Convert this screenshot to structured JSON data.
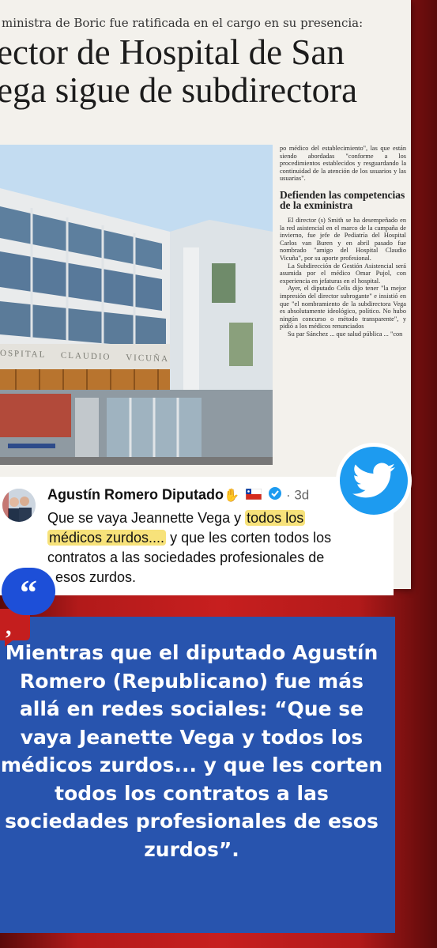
{
  "article": {
    "kicker": "ministra de Boric fue ratificada en el cargo en su presencia:",
    "headline_line1": "ector de Hospital de San",
    "headline_line2": "ega sigue de subdirectora",
    "photo_sign": "OSPITAL    CLAUDIO    VICUÑA",
    "col_para1": "po médico del establecimiento\", las que están siendo abordadas \"conforme a los procedimientos establecidos y resguardando la continuidad de la atención de los usuarios y las usuarias\".",
    "subhead": "Defienden las competencias de la exministra",
    "col_para2": "El director (s) Smith se ha desempeñado en la red asistencial en el marco de la campaña de invierno, fue jefe de Pediatría del Hospital Carlos van Buren y en abril pasado fue nombrado \"amigo del Hospital Claudio Vicuña\", por su aporte profesional.",
    "col_para3": "La Subdirección de Gestión Asistencial será asumida por el médico Omar Pujol, con experiencia en jefaturas en el hospital.",
    "col_para4": "Ayer, el diputado Celis dijo tener \"la mejor impresión del director subrogante\" e insistió en que \"el nombramiento de la subdirectora Vega es absolutamente ideológico, político. No hubo ningún concurso o método transparente\", y pidió a los médicos renunciados",
    "col_para5": "Su par Sánchez ... que salud pública ... \"con"
  },
  "tweet": {
    "author": "Agustín Romero Diputado",
    "emoji_hand": "✋",
    "time": "· 3d",
    "line1_a": "Que se vaya Jeannette Vega y ",
    "line1_hl": "todos los",
    "line2_hl": "médicos zurdos....",
    "line2_b": " y que les corten todos los",
    "line3": "contratos a las sociedades profesionales de",
    "line4": "esos zurdos."
  },
  "quote_mark": "“",
  "caption": {
    "text": "Mientras que el diputado Agustín Romero (Republicano) fue más allá en redes sociales: “Que se vaya Jeanette Vega y todos los médicos zurdos... y que les corten todos los contratos a las sociedades profesionales de esos zurdos”."
  },
  "colors": {
    "background_red": "#c71f1f",
    "caption_blue": "#2854ae",
    "twitter_blue": "#1d9bf0",
    "highlight_yellow": "#f7e27a"
  },
  "icons": [
    "twitter-bird-icon",
    "verified-badge-icon",
    "chile-flag-icon",
    "raised-hand-icon",
    "quote-icon"
  ]
}
